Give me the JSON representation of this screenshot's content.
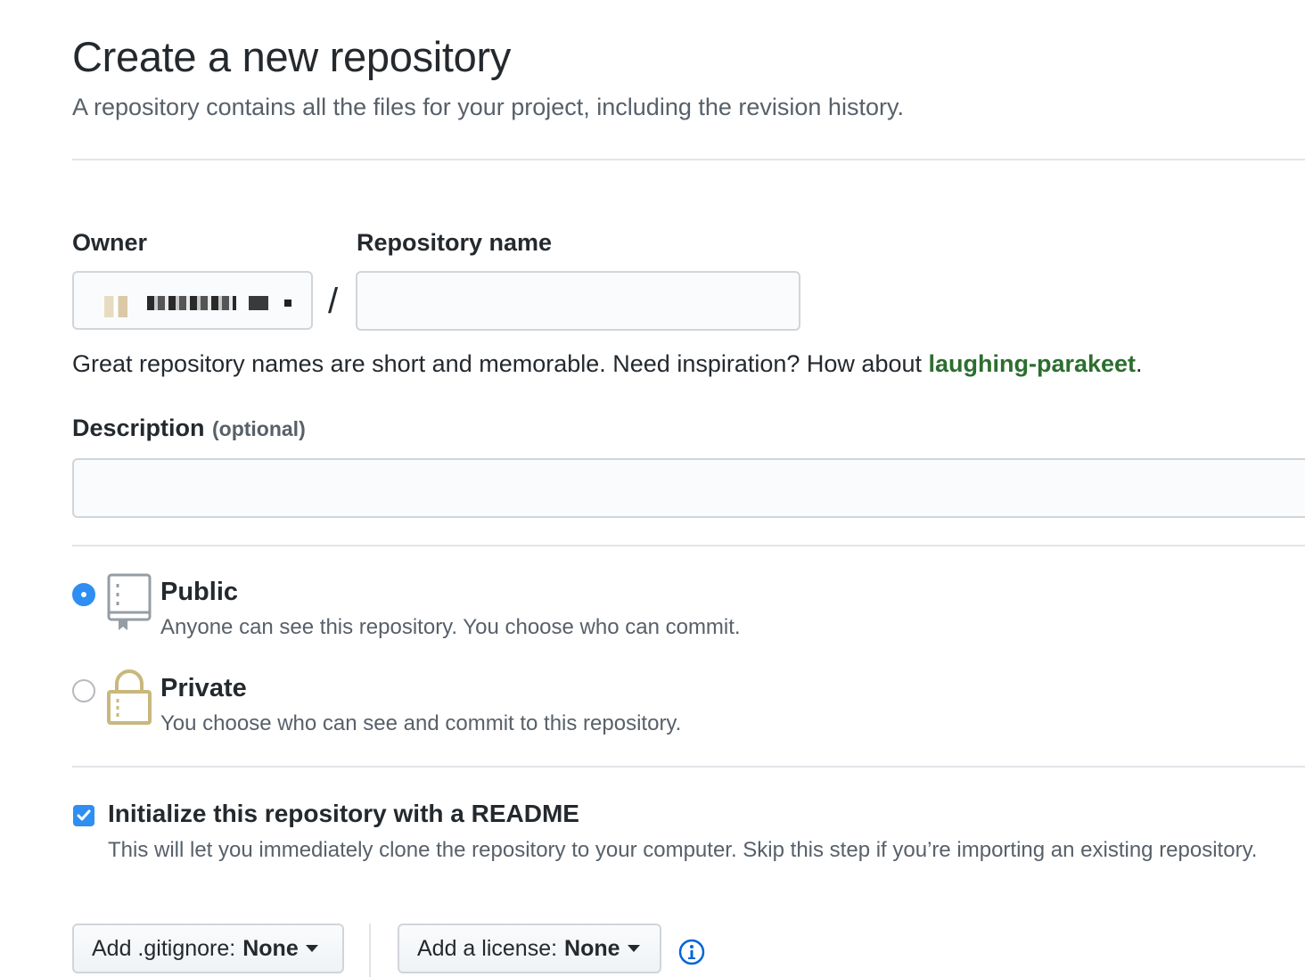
{
  "header": {
    "title": "Create a new repository",
    "subtitle": "A repository contains all the files for your project, including the revision history."
  },
  "owner": {
    "label": "Owner"
  },
  "repo_name": {
    "label": "Repository name",
    "value": "",
    "separator": "/"
  },
  "hint": {
    "text": "Great repository names are short and memorable. Need inspiration? How about ",
    "suggestion": "laughing-parakeet",
    "end": "."
  },
  "description": {
    "label": "Description",
    "optional": "(optional)",
    "value": ""
  },
  "visibility": {
    "public": {
      "title": "Public",
      "desc": "Anyone can see this repository. You choose who can commit.",
      "icon": "repo-book-icon",
      "checked": true
    },
    "private": {
      "title": "Private",
      "desc": "You choose who can see and commit to this repository.",
      "icon": "lock-icon",
      "checked": false
    }
  },
  "readme": {
    "title": "Initialize this repository with a README",
    "desc": "This will let you immediately clone the repository to your computer. Skip this step if you’re importing an existing repository.",
    "checked": true
  },
  "gitignore": {
    "label": "Add .gitignore:",
    "value": "None"
  },
  "license": {
    "label": "Add a license:",
    "value": "None"
  },
  "colors": {
    "accent": "#2f8ef1",
    "suggestion": "#2c6e2f",
    "lock": "#c8b87d"
  }
}
